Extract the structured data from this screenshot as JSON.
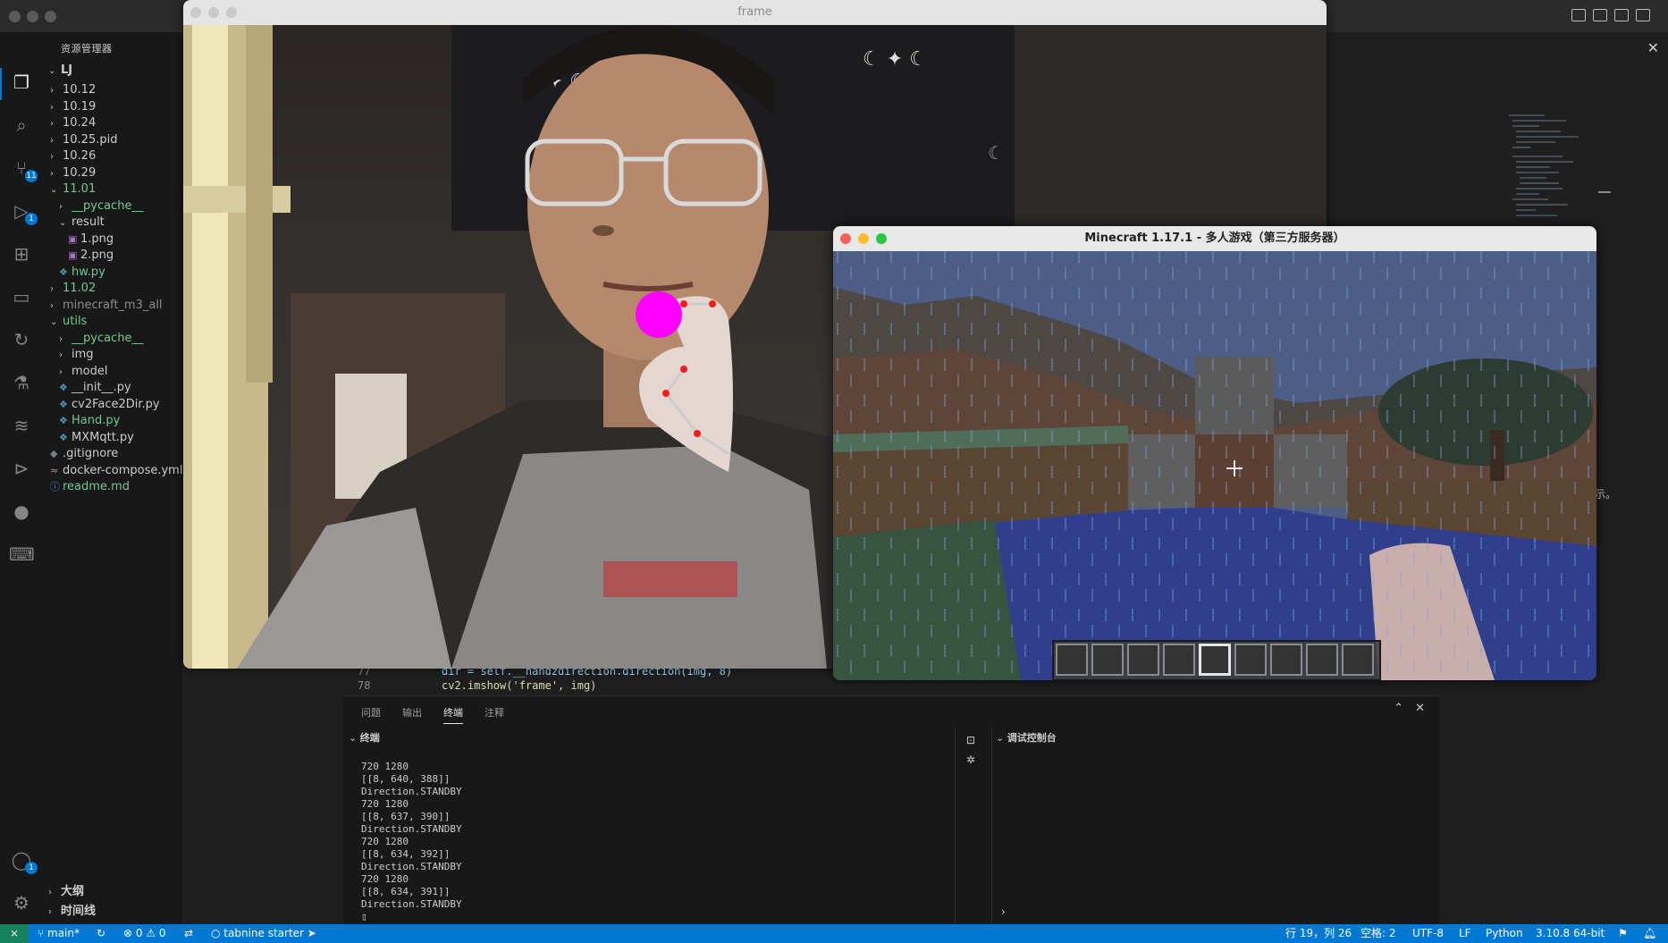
{
  "vscode": {
    "explorer_title": "资源管理器",
    "root_folder": "LJ",
    "tree": [
      {
        "label": "10.12",
        "kind": "folder",
        "color": "#cccccc",
        "depth": 0,
        "open": false
      },
      {
        "label": "10.19",
        "kind": "folder",
        "color": "#cccccc",
        "depth": 0,
        "open": false
      },
      {
        "label": "10.24",
        "kind": "folder",
        "color": "#cccccc",
        "depth": 0,
        "open": false
      },
      {
        "label": "10.25.pid",
        "kind": "folder",
        "color": "#cccccc",
        "depth": 0,
        "open": false
      },
      {
        "label": "10.26",
        "kind": "folder",
        "color": "#cccccc",
        "depth": 0,
        "open": false
      },
      {
        "label": "10.29",
        "kind": "folder",
        "color": "#cccccc",
        "depth": 0,
        "open": false
      },
      {
        "label": "11.01",
        "kind": "folder",
        "color": "#73c991",
        "depth": 0,
        "open": true
      },
      {
        "label": "__pycache__",
        "kind": "folder",
        "color": "#73c991",
        "depth": 1,
        "open": false
      },
      {
        "label": "result",
        "kind": "folder",
        "color": "#cccccc",
        "depth": 1,
        "open": true
      },
      {
        "label": "1.png",
        "kind": "image",
        "color": "#cccccc",
        "depth": 2
      },
      {
        "label": "2.png",
        "kind": "image",
        "color": "#cccccc",
        "depth": 2
      },
      {
        "label": "hw.py",
        "kind": "py",
        "color": "#73c991",
        "depth": 1
      },
      {
        "label": "11.02",
        "kind": "folder",
        "color": "#73c991",
        "depth": 0,
        "open": false
      },
      {
        "label": "minecraft_m3_all",
        "kind": "folder",
        "color": "#8c8c8c",
        "depth": 0,
        "open": false
      },
      {
        "label": "utils",
        "kind": "folder",
        "color": "#73c991",
        "depth": 0,
        "open": true
      },
      {
        "label": "__pycache__",
        "kind": "folder",
        "color": "#73c991",
        "depth": 1,
        "open": false
      },
      {
        "label": "img",
        "kind": "folder",
        "color": "#cccccc",
        "depth": 1,
        "open": false
      },
      {
        "label": "model",
        "kind": "folder",
        "color": "#cccccc",
        "depth": 1,
        "open": false
      },
      {
        "label": "__init__.py",
        "kind": "py",
        "color": "#cccccc",
        "depth": 1
      },
      {
        "label": "cv2Face2Dir.py",
        "kind": "py",
        "color": "#cccccc",
        "depth": 1
      },
      {
        "label": "Hand.py",
        "kind": "py",
        "color": "#73c991",
        "depth": 1
      },
      {
        "label": "MXMqtt.py",
        "kind": "py",
        "color": "#cccccc",
        "depth": 1
      },
      {
        "label": ".gitignore",
        "kind": "git",
        "color": "#cccccc",
        "depth": 0
      },
      {
        "label": "docker-compose.yml",
        "kind": "docker",
        "color": "#cccccc",
        "depth": 0
      },
      {
        "label": "readme.md",
        "kind": "info",
        "color": "#73c991",
        "depth": 0
      }
    ],
    "outline_label": "大纲",
    "timeline_label": "时间线",
    "activity_badges": {
      "scm": "11",
      "debug": "1",
      "accounts": "1"
    },
    "code_lines": [
      {
        "num": "77",
        "text": "dir = self.__handzdirection.direction(img, 8)"
      },
      {
        "num": "78",
        "text": "cv2.imshow('frame', img)"
      }
    ],
    "panel_tabs": [
      "问题",
      "输出",
      "终端",
      "注释"
    ],
    "panel_active_tab": "终端",
    "terminal_header": "终端",
    "debug_console_header": "调试控制台",
    "terminal_lines": [
      "720 1280",
      "[[8, 640, 388]]",
      "Direction.STANDBY",
      "720 1280",
      "[[8, 637, 390]]",
      "Direction.STANDBY",
      "720 1280",
      "[[8, 634, 392]]",
      "Direction.STANDBY",
      "720 1280",
      "[[8, 634, 391]]",
      "Direction.STANDBY"
    ],
    "right_edge_text": "示。",
    "status": {
      "branch": "main*",
      "errors": "0",
      "warnings": "0",
      "tabnine": "tabnine starter",
      "position": "行 19，列 26",
      "spaces": "空格: 2",
      "encoding": "UTF-8",
      "eol": "LF",
      "language": "Python",
      "interpreter": "3.10.8 64-bit"
    }
  },
  "frame_window": {
    "title": "frame"
  },
  "minecraft_window": {
    "title": "Minecraft 1.17.1 - 多人游戏（第三方服务器）",
    "hotbar_slots": 9,
    "selected_slot": 5
  },
  "colors": {
    "accent": "#0078d4",
    "git_added": "#73c991",
    "hand_marker": "#ff00ff",
    "landmark": "#ff1a1a"
  }
}
